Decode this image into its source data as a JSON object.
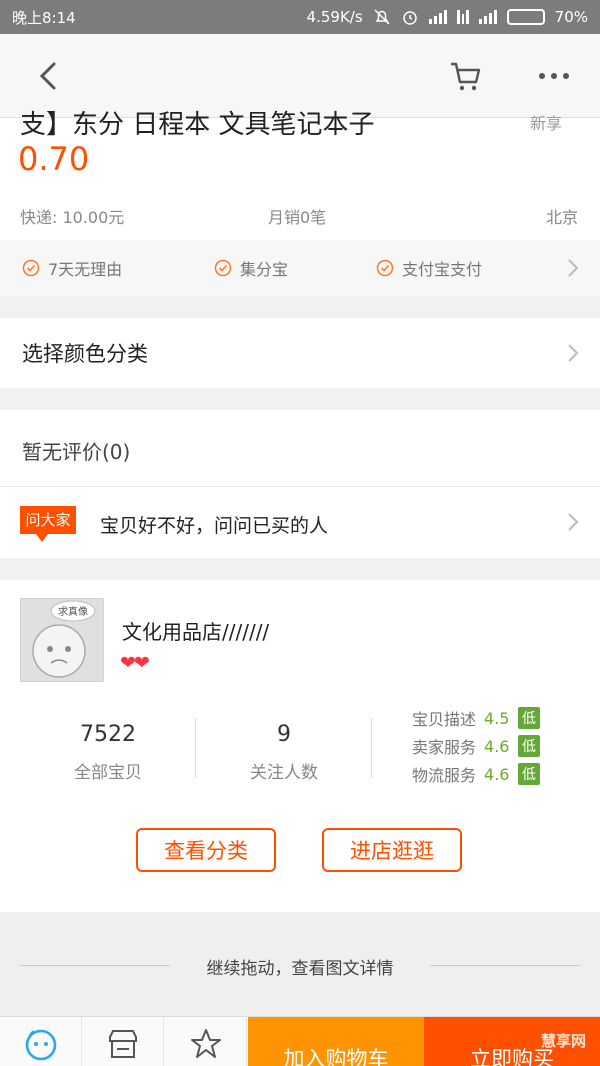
{
  "status_bar": {
    "time": "晚上8:14",
    "speed": "4.59K/s",
    "battery": "70%",
    "battery_level": 0.7
  },
  "nav": {
    "back_icon": "chevron-left-icon",
    "cart_icon": "cart-icon",
    "more_icon": "more-dots-icon"
  },
  "product": {
    "title_cut": "支】东分 日程本 文具笔记本子",
    "title_right": "新享",
    "price": "0.70",
    "shipping": "快递: 10.00元",
    "monthly_sales": "月销0笔",
    "location": "北京"
  },
  "services": [
    "7天无理由",
    "集分宝",
    "支付宝支付"
  ],
  "options": {
    "select_color": "选择颜色分类"
  },
  "reviews": {
    "title": "暂无评价(0)",
    "ask_badge": "问大家",
    "ask_text": "宝贝好不好，问问已买的人"
  },
  "shop": {
    "avatar_caption": "求真像",
    "name": "文化用品店///////",
    "rating": "❤❤",
    "stats": [
      {
        "value": "7522",
        "label": "全部宝贝"
      },
      {
        "value": "9",
        "label": "关注人数"
      }
    ],
    "scores": [
      {
        "label": "宝贝描述",
        "value": "4.5",
        "tag": "低"
      },
      {
        "label": "卖家服务",
        "value": "4.6",
        "tag": "低"
      },
      {
        "label": "物流服务",
        "value": "4.6",
        "tag": "低"
      }
    ],
    "btn_category": "查看分类",
    "btn_enter": "进店逛逛",
    "accent": "#ff5000",
    "score_color": "#65a838"
  },
  "drag_hint": "继续拖动，查看图文详情",
  "tabbar": {
    "icons": [
      "service-chat-icon",
      "shop-icon",
      "favorite-star-icon"
    ],
    "add_to_cart": "加入购物车",
    "buy_now": "立即购买",
    "cart_color": "#ff9402",
    "buy_color": "#ff5000"
  },
  "watermark": "慧享网"
}
